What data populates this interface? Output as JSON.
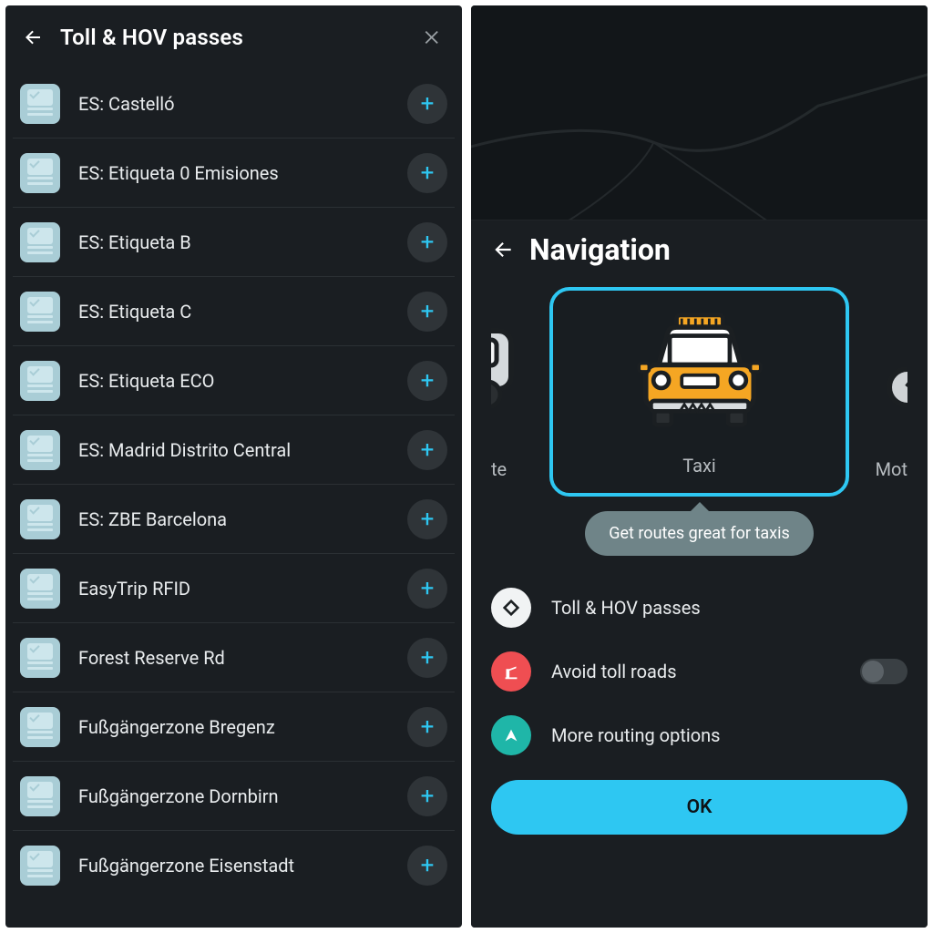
{
  "left": {
    "title": "Toll & HOV passes",
    "items": [
      {
        "label": "ES: Castelló"
      },
      {
        "label": "ES: Etiqueta 0 Emisiones"
      },
      {
        "label": "ES: Etiqueta B"
      },
      {
        "label": "ES: Etiqueta C"
      },
      {
        "label": "ES: Etiqueta ECO"
      },
      {
        "label": "ES: Madrid Distrito Central"
      },
      {
        "label": "ES: ZBE Barcelona"
      },
      {
        "label": "EasyTrip RFID"
      },
      {
        "label": "Forest Reserve Rd"
      },
      {
        "label": "Fußgängerzone Bregenz"
      },
      {
        "label": "Fußgängerzone Dornbirn"
      },
      {
        "label": "Fußgängerzone Eisenstadt"
      }
    ]
  },
  "right": {
    "title": "Navigation",
    "vehicles": {
      "left_partial_label": "te",
      "selected_label": "Taxi",
      "right_partial_label": "Mot"
    },
    "tooltip": "Get routes great for taxis",
    "options": {
      "toll_passes": "Toll & HOV passes",
      "avoid_toll": "Avoid toll roads",
      "more": "More routing options"
    },
    "ok": "OK",
    "avoid_toll_enabled": false
  },
  "icons": {
    "plus": "+"
  }
}
